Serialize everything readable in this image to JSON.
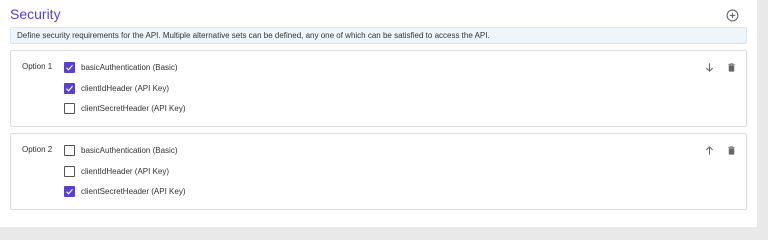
{
  "header": {
    "title": "Security",
    "info_text": "Define security requirements for the API. Multiple alternative sets can be defined, any one of which can be satisfied to access the API.",
    "add_icon": "plus-circle-icon"
  },
  "options": [
    {
      "label": "Option 1",
      "move_icon": "arrow-down-icon",
      "delete_icon": "trash-icon",
      "schemes": [
        {
          "label": "basicAuthentication (Basic)",
          "checked": true
        },
        {
          "label": "clientIdHeader (API Key)",
          "checked": true
        },
        {
          "label": "clientSecretHeader (API Key)",
          "checked": false
        }
      ]
    },
    {
      "label": "Option 2",
      "move_icon": "arrow-up-icon",
      "delete_icon": "trash-icon",
      "schemes": [
        {
          "label": "basicAuthentication (Basic)",
          "checked": false
        },
        {
          "label": "clientIdHeader (API Key)",
          "checked": false
        },
        {
          "label": "clientSecretHeader (API Key)",
          "checked": true
        }
      ]
    }
  ],
  "colors": {
    "accent": "#5a3fd6",
    "info_bg": "#eef6fb",
    "icon": "#666666"
  }
}
